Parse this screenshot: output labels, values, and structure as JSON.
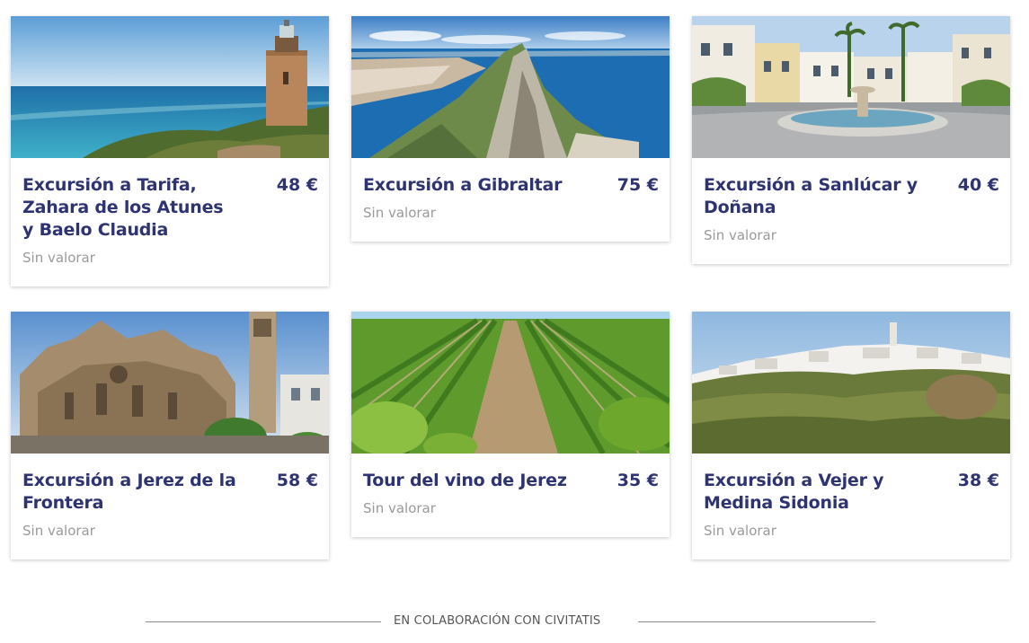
{
  "tours": [
    {
      "title": "Excursión a Tarifa, Zahara de los Atunes y Baelo Claudia",
      "price": "48 €",
      "rating": "Sin valorar",
      "image": "tarifa-lighthouse-coast"
    },
    {
      "title": "Excursión a Gibraltar",
      "price": "75 €",
      "rating": "Sin valorar",
      "image": "gibraltar-rock"
    },
    {
      "title": "Excursión a Sanlúcar y Doñana",
      "price": "40 €",
      "rating": "Sin valorar",
      "image": "sanlucar-plaza-fountain"
    },
    {
      "title": "Excursión a Jerez de la Frontera",
      "price": "58 €",
      "rating": "Sin valorar",
      "image": "jerez-cathedral"
    },
    {
      "title": "Tour del vino de Jerez",
      "price": "35 €",
      "rating": "Sin valorar",
      "image": "vineyard-rows"
    },
    {
      "title": "Excursión a Vejer y Medina Sidonia",
      "price": "38 €",
      "rating": "Sin valorar",
      "image": "white-village-hill"
    }
  ],
  "footer": {
    "text": "EN COLABORACIÓN CON CIVITATIS"
  },
  "colors": {
    "title": "#2e3372",
    "rating": "#9a9a9a"
  }
}
